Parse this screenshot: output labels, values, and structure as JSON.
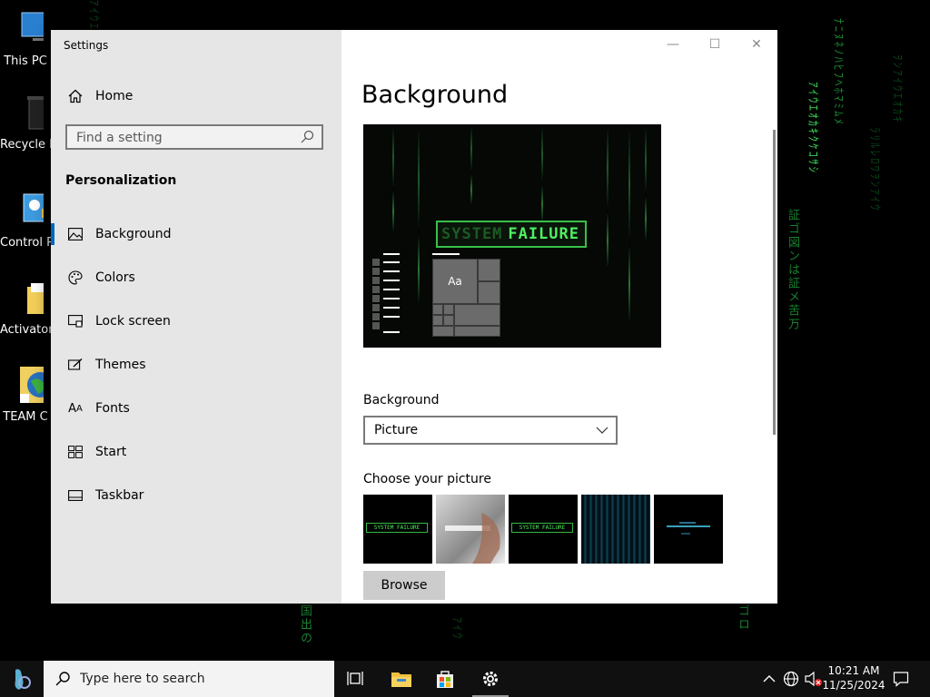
{
  "desktop": {
    "icons": [
      {
        "label": "This PC"
      },
      {
        "label": "Recycle Bin"
      },
      {
        "label": "Control Panel"
      },
      {
        "label": "Activator"
      },
      {
        "label": "TEAM C"
      }
    ]
  },
  "window": {
    "title": "Settings",
    "controls": {
      "minimize": "—",
      "maximize": "☐",
      "close": "✕"
    },
    "sidebar": {
      "home_label": "Home",
      "search_placeholder": "Find a setting",
      "section_title": "Personalization",
      "items": [
        {
          "label": "Background",
          "icon": "picture-icon",
          "selected": true
        },
        {
          "label": "Colors",
          "icon": "palette-icon"
        },
        {
          "label": "Lock screen",
          "icon": "lock-screen-icon"
        },
        {
          "label": "Themes",
          "icon": "themes-icon"
        },
        {
          "label": "Fonts",
          "icon": "fonts-icon"
        },
        {
          "label": "Start",
          "icon": "start-icon"
        },
        {
          "label": "Taskbar",
          "icon": "taskbar-icon"
        }
      ]
    },
    "main": {
      "page_title": "Background",
      "preview": {
        "banner_faded": "SYSTEM",
        "banner_text": "FAILURE",
        "tile_text": "Aa"
      },
      "background_label": "Background",
      "background_value": "Picture",
      "choose_label": "Choose your picture",
      "thumb_text": "SYSTEM FAILURE",
      "browse_label": "Browse"
    }
  },
  "taskbar": {
    "search_placeholder": "Type here to search",
    "time": "10:21 AM",
    "date": "11/25/2024"
  },
  "colors": {
    "accent": "#0067c0",
    "matrix_green": "#4ef060"
  }
}
